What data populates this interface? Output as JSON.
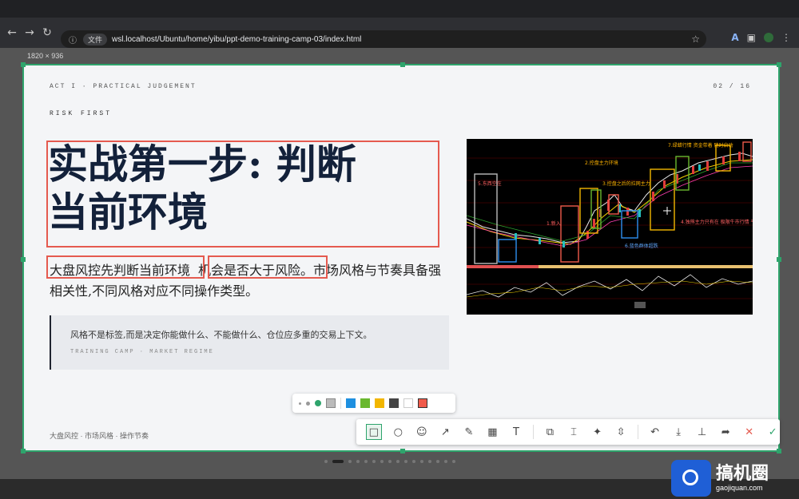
{
  "browser": {
    "security_chip": "文件",
    "url": "wsl.localhost/Ubuntu/home/yibu/ppt-demo-training-camp-03/index.html"
  },
  "viewport_label": "1820 × 936",
  "slide": {
    "act_label": "ACT I · PRACTICAL JUDGEMENT",
    "page_label": "02 / 16",
    "kicker": "RISK FIRST",
    "title_line1": "实战第一步: 判断",
    "title_line2": "当前环境",
    "para_part1": "大盘风控先判断当前环境",
    "para_part2": "机会是否大于风险。",
    "para_part3": "市场风格与节奏具备强相关性,不同风格对应不同操作类型。",
    "quote_text": "风格不是标签,而是决定你能做什么、不能做什么、仓位应多重的交易上下文。",
    "quote_sub": "TRAINING CAMP · MARKET REGIME",
    "footer": "大盘风控 · 市场风格 · 操作节奏",
    "chart_annotations": [
      "5.东西空在",
      "2.控盘主力环境",
      "3.控盘之后的拉网主力",
      "7.绿蜡行情 资金带着 随时启动",
      "1.新入",
      "6.蓝色群体超跌",
      "4.独熊主力只有在 极限牛市行情 平均股价长期稳场上 方(深证)"
    ]
  },
  "colors": {
    "accent_green": "#2ea46c",
    "annotation_red": "#e55a4f",
    "palette": [
      "#1e90e0",
      "#6ab82f",
      "#f2b600",
      "#444444",
      "#ffffff",
      "#f05a4a"
    ]
  },
  "pagination": {
    "total": 16,
    "current": 2
  },
  "toolbar_icons": [
    "rectangle-icon",
    "ellipse-icon",
    "emoji-icon",
    "arrow-icon",
    "pencil-icon",
    "mosaic-icon",
    "text-icon",
    "pin-icon",
    "ocr-icon",
    "magic-icon",
    "scroll-capture-icon",
    "undo-icon",
    "save-icon",
    "pin-top-icon",
    "share-icon",
    "close-icon",
    "confirm-icon"
  ],
  "watermark": {
    "title": "搞机圈",
    "domain": "gaojiquan.com"
  }
}
